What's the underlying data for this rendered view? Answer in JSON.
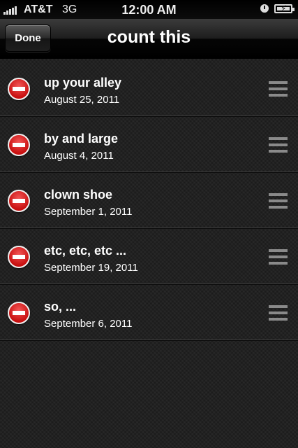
{
  "status_bar": {
    "carrier": "AT&T",
    "network": "3G",
    "time": "12:00 AM",
    "icons": [
      "signal-bars-icon",
      "alarm-clock-icon",
      "battery-charging-icon"
    ]
  },
  "nav_bar": {
    "done_label": "Done",
    "title": "count this"
  },
  "rows": [
    {
      "title": "up your alley",
      "date": "August 25, 2011"
    },
    {
      "title": "by and large",
      "date": "August 4, 2011"
    },
    {
      "title": "clown shoe",
      "date": "September 1, 2011"
    },
    {
      "title": "etc, etc, etc ...",
      "date": "September 19, 2011"
    },
    {
      "title": "so, ...",
      "date": "September 6, 2011"
    }
  ],
  "colors": {
    "delete_red": "#d01515",
    "background": "#1e1e1e",
    "separator": "#3c3c3c",
    "reorder_grip": "#8a8a8a"
  }
}
